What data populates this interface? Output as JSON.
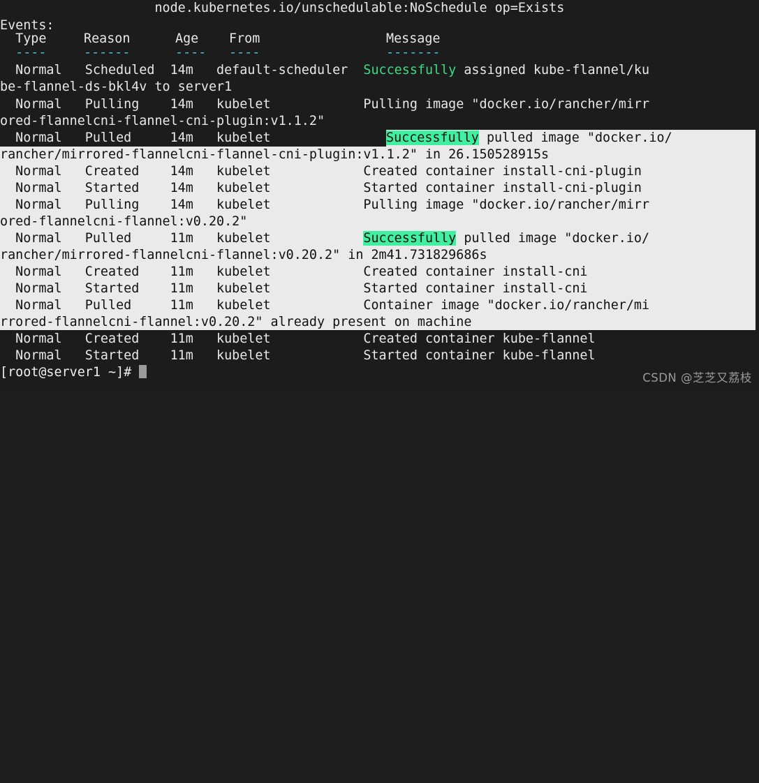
{
  "terminal": {
    "title": "kubectl describe pod — Events",
    "colors": {
      "background": "#1c1c1e",
      "foreground": "#e8e8e8",
      "cyan": "#46c6e0",
      "green": "#3ddc84",
      "highlight_bg": "#3ef0a0",
      "highlight_fg": "#101010",
      "selection_bg": "#eaeaea",
      "selection_fg": "#111111",
      "cursor": "#9b9b9b",
      "watermark": "#9a9a9a"
    },
    "toleration_line": "node.kubernetes.io/unschedulable:NoSchedule op=Exists",
    "events_label": "Events:",
    "headers": {
      "type": "Type",
      "reason": "Reason",
      "age": "Age",
      "from": "From",
      "message": "Message"
    },
    "header_rules": {
      "type": "----",
      "reason": "------",
      "age": "----",
      "from": "----",
      "message": "-------"
    },
    "events": [
      {
        "type": "Normal",
        "reason": "Scheduled",
        "age": "14m",
        "from": "default-scheduler",
        "message_prefix": "",
        "message_green": "Successfully",
        "message_rest": " assigned kube-flannel/ku",
        "wrap": "be-flannel-ds-bkl4v to server1",
        "selected": false
      },
      {
        "type": "Normal",
        "reason": "Pulling",
        "age": "14m",
        "from": "kubelet",
        "message_prefix": "Pulling image \"docker.io/rancher/mirr",
        "message_green": "",
        "message_rest": "",
        "wrap": "ored-flannelcni-flannel-cni-plugin:v1.1.2\"",
        "selected": false
      },
      {
        "type": "Normal",
        "reason": "Pulled",
        "age": "14m",
        "from": "kubelet",
        "message_prefix": "",
        "message_green": "Successfully",
        "message_rest": " pulled image \"docker.io/",
        "wrap": "rancher/mirrored-flannelcni-flannel-cni-plugin:v1.1.2\" in 26.150528915s",
        "selected": true
      },
      {
        "type": "Normal",
        "reason": "Created",
        "age": "14m",
        "from": "kubelet",
        "message_prefix": "Created container install-cni-plugin",
        "message_green": "",
        "message_rest": "",
        "wrap": "",
        "selected": true
      },
      {
        "type": "Normal",
        "reason": "Started",
        "age": "14m",
        "from": "kubelet",
        "message_prefix": "Started container install-cni-plugin",
        "message_green": "",
        "message_rest": "",
        "wrap": "",
        "selected": true
      },
      {
        "type": "Normal",
        "reason": "Pulling",
        "age": "14m",
        "from": "kubelet",
        "message_prefix": "Pulling image \"docker.io/rancher/mirr",
        "message_green": "",
        "message_rest": "",
        "wrap": "ored-flannelcni-flannel:v0.20.2\"",
        "selected": true
      },
      {
        "type": "Normal",
        "reason": "Pulled",
        "age": "11m",
        "from": "kubelet",
        "message_prefix": "",
        "message_green": "Successfully",
        "message_rest": " pulled image \"docker.io/",
        "wrap": "rancher/mirrored-flannelcni-flannel:v0.20.2\" in 2m41.731829686s",
        "selected": true
      },
      {
        "type": "Normal",
        "reason": "Created",
        "age": "11m",
        "from": "kubelet",
        "message_prefix": "Created container install-cni",
        "message_green": "",
        "message_rest": "",
        "wrap": "",
        "selected": true
      },
      {
        "type": "Normal",
        "reason": "Started",
        "age": "11m",
        "from": "kubelet",
        "message_prefix": "Started container install-cni",
        "message_green": "",
        "message_rest": "",
        "wrap": "",
        "selected": true
      },
      {
        "type": "Normal",
        "reason": "Pulled",
        "age": "11m",
        "from": "kubelet",
        "message_prefix": "Container image \"docker.io/rancher/mi",
        "message_green": "",
        "message_rest": "",
        "wrap": "rrored-flannelcni-flannel:v0.20.2\" already present on machine",
        "selected": true
      },
      {
        "type": "Normal",
        "reason": "Created",
        "age": "11m",
        "from": "kubelet",
        "message_prefix": "Created container kube-flannel",
        "message_green": "",
        "message_rest": "",
        "wrap": "",
        "selected": false
      },
      {
        "type": "Normal",
        "reason": "Started",
        "age": "11m",
        "from": "kubelet",
        "message_prefix": "Started container kube-flannel",
        "message_green": "",
        "message_rest": "",
        "wrap": "",
        "selected": false
      }
    ],
    "prompt": "[root@server1 ~]# ",
    "cursor": "block",
    "lines": {
      "l00": "                    node.kubernetes.io/unschedulable:NoSchedule op=Exists",
      "l01": "Events:",
      "l02_type": "  Type",
      "l02_reason": "Reason",
      "l02_age": "Age",
      "l02_from": "From",
      "l02_message": "Message",
      "l03_type": "  ----",
      "l03_reason": "------",
      "l03_age": "----",
      "l03_from": "----",
      "l03_message": "-------",
      "l04_left": "  Normal   Scheduled  14m   default-scheduler  ",
      "l04_green": "Successfully",
      "l04_rest": " assigned kube-flannel/ku",
      "l05": "be-flannel-ds-bkl4v to server1",
      "l06": "  Normal   Pulling    14m   kubelet            Pulling image \"docker.io/rancher/mirr",
      "l07": "ored-flannelcni-flannel-cni-plugin:v1.1.2\"",
      "l08_left": "  Normal   Pulled     14m   kubelet            ",
      "l08_hl": "Successfully",
      "l08_rest": " pulled image \"docker.io/",
      "l09": "rancher/mirrored-flannelcni-flannel-cni-plugin:v1.1.2\" in 26.150528915s",
      "l10": "  Normal   Created    14m   kubelet            Created container install-cni-plugin",
      "l11": "  Normal   Started    14m   kubelet            Started container install-cni-plugin",
      "l12": "  Normal   Pulling    14m   kubelet            Pulling image \"docker.io/rancher/mirr",
      "l13": "ored-flannelcni-flannel:v0.20.2\"",
      "l14_left": "  Normal   Pulled     11m   kubelet            ",
      "l14_hl": "Successfully",
      "l14_rest": " pulled image \"docker.io/",
      "l15": "rancher/mirrored-flannelcni-flannel:v0.20.2\" in 2m41.731829686s",
      "l16": "  Normal   Created    11m   kubelet            Created container install-cni",
      "l17": "  Normal   Started    11m   kubelet            Started container install-cni",
      "l18": "  Normal   Pulled     11m   kubelet            Container image \"docker.io/rancher/mi",
      "l19": "rrored-flannelcni-flannel:v0.20.2\" already present on machine",
      "l20": "  Normal   Created    11m   kubelet            Created container kube-flannel",
      "l21": "  Normal   Started    11m   kubelet            Started container kube-flannel",
      "l22_prompt": "[root@server1 ~]# "
    }
  },
  "watermark": {
    "text": "CSDN @芝芝又荔枝"
  }
}
